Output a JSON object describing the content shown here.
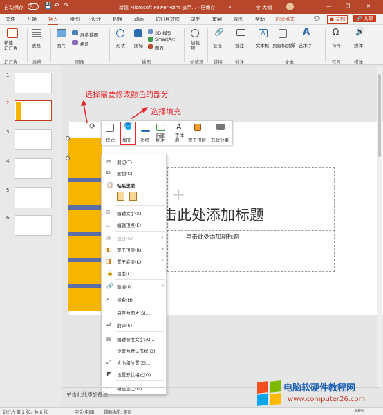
{
  "titlebar": {
    "autosave": "自动保存",
    "autosave_state": "关",
    "title": "新建 Microsoft PowerPoint 演示... · 已保存",
    "user": "李 大帽",
    "window": {
      "minimize": "—",
      "restore": "❐",
      "close": "✕"
    }
  },
  "tabs": [
    "文件",
    "开始",
    "插入",
    "绘图",
    "设计",
    "切换",
    "动画",
    "幻灯片放映",
    "录制",
    "审阅",
    "视图",
    "帮助",
    "形状格式"
  ],
  "tab_right": {
    "comment": "💬",
    "record": "● 录制",
    "share": "🔗 共享"
  },
  "ribbon": {
    "new_slide": "新建\n幻灯片",
    "table": "表格",
    "images": "图片",
    "screenshot": "屏幕截图",
    "album": "相册",
    "shapes": "形状",
    "icons": "图标",
    "model3d": "3D 模型",
    "smartart": "SmartArt",
    "chart": "图表",
    "addins": "加载\n项",
    "link": "链接",
    "comment": "批注",
    "textbox": "文本框",
    "header_footer": "页眉和页脚",
    "wordart": "艺术字",
    "symbol": "符号",
    "media": "媒体",
    "groups": {
      "slides": "幻灯片",
      "tables": "表格",
      "images": "图像",
      "illustrations": "插图",
      "addins": "加载项",
      "links": "链接",
      "comments": "批注",
      "text": "文本",
      "symbols": "符号",
      "media": "媒体"
    }
  },
  "thumbnails": [
    "1",
    "2",
    "3",
    "4",
    "5",
    "6"
  ],
  "slide": {
    "title_placeholder": "击此处添加标题",
    "subtitle_placeholder": "单击此处添加副标题",
    "notes": "单击此处添加备注"
  },
  "mini_toolbar": {
    "style": "样式",
    "fill": "填充",
    "outline": "边框",
    "new_comment": "新建\n批注",
    "font": "字体\n颜",
    "bring_front": "置于顶层",
    "shape_effects": "形状效果"
  },
  "context_menu": {
    "cut": "剪切(T)",
    "copy": "复制(C)",
    "paste_options": "粘贴选项:",
    "edit_text": "编辑文字(X)",
    "edit_points": "编辑顶点(E)",
    "group": "组合(G)",
    "bring_front": "置于顶层(R)",
    "send_back": "置于底层(K)",
    "lock": "锁定(L)",
    "link": "链接(I)",
    "search": "搜索(H)",
    "save_as_picture": "另存为图片(S)...",
    "translate": "翻译(S)",
    "alt_text": "编辑替换文字(A)...",
    "default_shape": "设置为默认形状(D)",
    "size_position": "大小和位置(Z)...",
    "format_shape": "设置形状格式(O)...",
    "new_comment": "新建批注(M)"
  },
  "annotations": {
    "select_part": "选择需要修改颜色的部分",
    "select_fill": "选择填充"
  },
  "status": {
    "slide_info": "幻灯片 第 2 张，共 6 张",
    "language": "中文(中国)",
    "accessibility": "辅助功能: 调查",
    "zoom": "60%"
  },
  "watermark": {
    "cn": "电脑软硬件教程网",
    "url": "www.computer26.com"
  },
  "colors": {
    "accent": "#b7472a",
    "shape_yellow": "#f7b500",
    "stripe": "#5b6ea8",
    "annotation": "#e8262b"
  }
}
